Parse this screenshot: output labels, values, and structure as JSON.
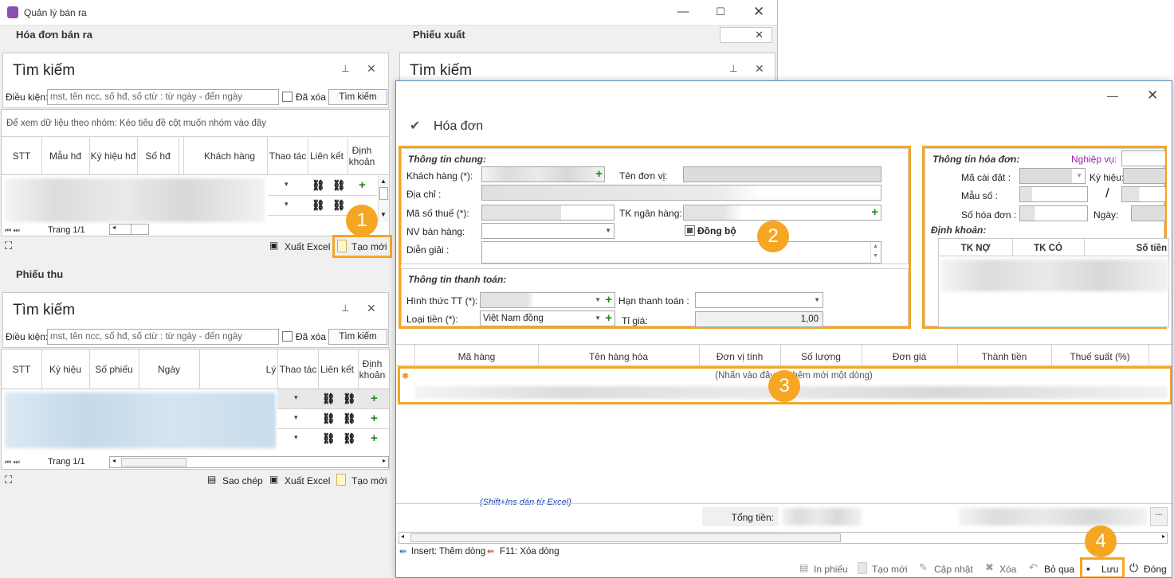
{
  "main_window": {
    "title": "Quản lý bán ra",
    "sections": {
      "invoice": "Hóa đơn bán ra",
      "export": "Phiếu xuất",
      "receipt": "Phiếu thu"
    },
    "search": {
      "title": "Tìm kiếm",
      "condition_label": "Điều kiện:",
      "placeholder": "mst, tên ncc, số hđ, số ctừ : từ ngày - đến ngày",
      "deleted_label": "Đã xóa",
      "search_button": "Tìm kiếm"
    },
    "group_hint": "Để xem dữ liệu theo nhóm: Kéo tiêu đề cột muốn nhóm vào đây",
    "invoice_grid_columns": [
      "STT",
      "Mẫu hđ",
      "Ký hiệu hđ",
      "Số hđ",
      "Khách hàng",
      "Thao tác",
      "Liên kết",
      "Định khoản"
    ],
    "receipt_grid_columns": [
      "STT",
      "Ký hiệu",
      "Số phiếu",
      "Ngày",
      "Lý",
      "Thao tác",
      "Liên kết",
      "Định khoản"
    ],
    "pager": "Trang 1/1",
    "toolbar": {
      "copy": "Sao chép",
      "export_excel": "Xuất Excel",
      "create_new": "Tạo mới"
    }
  },
  "dialog": {
    "title": "Hóa đơn",
    "general": {
      "title": "Thông tin chung:",
      "customer": "Khách hàng (*):",
      "unit_name": "Tên đơn vị:",
      "address": "Địa chỉ :",
      "tax_code": "Mã số thuế (*):",
      "bank_account": "TK ngân hàng:",
      "salesperson": "NV bán hàng:",
      "sync": "Đồng bộ",
      "description": "Diễn giải :"
    },
    "payment": {
      "title": "Thông tin thanh toán:",
      "method": "Hình thức TT (*):",
      "due_date": "Hạn thanh toán :",
      "currency": "Loại tiền (*):",
      "currency_value": "Việt Nam đồng",
      "rate": "Tỉ giá:",
      "rate_value": "1,00"
    },
    "invoice_info": {
      "title": "Thông tin hóa đơn:",
      "business": "Nghiệp vụ:",
      "setting_code": "Mã cài đặt :",
      "symbol": "Ký hiệu:",
      "form_no": "Mẫu số :",
      "separator": "/",
      "invoice_no": "Số hóa đơn :",
      "date": "Ngày:",
      "accounting": "Định khoản:",
      "accounting_columns": [
        "TK NỢ",
        "TK CÓ",
        "Số tiền"
      ]
    },
    "detail_columns": [
      "Mã hàng",
      "Tên hàng hóa",
      "Đơn vị tính",
      "Số lượng",
      "Đơn giá",
      "Thành tiền",
      "Thuế suất (%)"
    ],
    "new_row_hint": "(Nhấn vào đây để thêm mới một dòng)",
    "excel_hint": "(Shift+Ins dán từ Excel)",
    "total_label": "Tổng tiền:",
    "ellipsis": "...",
    "shortcuts": {
      "insert": "Insert: Thêm dòng",
      "delete": "F11: Xóa dòng"
    },
    "buttons": {
      "print": "In phiếu",
      "create": "Tạo mới",
      "update": "Cập nhật",
      "delete": "Xóa",
      "skip": "Bỏ qua",
      "save": "Lưu",
      "close": "Đóng"
    }
  },
  "badges": [
    "1",
    "2",
    "3",
    "4"
  ],
  "colors": {
    "highlight": "#f5a623",
    "plus": "#1a8a1a",
    "dialog_border": "#5b8fc7",
    "business_label": "#9b1fa8"
  }
}
